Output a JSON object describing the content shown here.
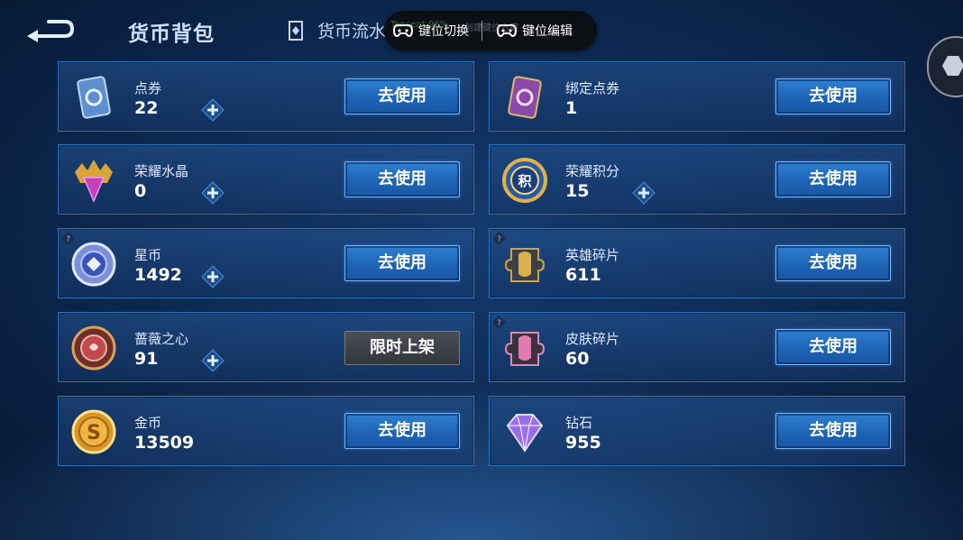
{
  "header": {
    "title": "货币背包",
    "tab_flow": "货币流水"
  },
  "overlay": {
    "ghost_text_1": "Tencent 96%",
    "ghost_text_2": "创建键位方案",
    "switch_label": "键位切换",
    "edit_label": "键位编辑"
  },
  "items": [
    {
      "name": "点券",
      "amount": "22",
      "action": "去使用",
      "icon": "coupon-card-icon",
      "has_plus": true,
      "has_help": false
    },
    {
      "name": "绑定点券",
      "amount": "1",
      "action": "去使用",
      "icon": "bound-coupon-card-icon",
      "has_plus": false,
      "has_help": false
    },
    {
      "name": "荣耀水晶",
      "amount": "0",
      "action": "去使用",
      "icon": "glory-crystal-icon",
      "has_plus": true,
      "has_help": false
    },
    {
      "name": "荣耀积分",
      "amount": "15",
      "action": "去使用",
      "icon": "glory-points-icon",
      "has_plus": true,
      "has_help": false
    },
    {
      "name": "星币",
      "amount": "1492",
      "action": "去使用",
      "icon": "star-coin-icon",
      "has_plus": true,
      "has_help": true
    },
    {
      "name": "英雄碎片",
      "amount": "611",
      "action": "去使用",
      "icon": "hero-fragment-icon",
      "has_plus": false,
      "has_help": true
    },
    {
      "name": "蔷薇之心",
      "amount": "91",
      "action": "限时上架",
      "icon": "rose-heart-icon",
      "has_plus": true,
      "has_help": false
    },
    {
      "name": "皮肤碎片",
      "amount": "60",
      "action": "去使用",
      "icon": "skin-fragment-icon",
      "has_plus": false,
      "has_help": true
    },
    {
      "name": "金币",
      "amount": "13509",
      "action": "去使用",
      "icon": "gold-coin-icon",
      "has_plus": false,
      "has_help": false
    },
    {
      "name": "钻石",
      "amount": "955",
      "action": "去使用",
      "icon": "diamond-icon",
      "has_plus": false,
      "has_help": false
    }
  ],
  "colors": {
    "button_blue": "#1e64b5",
    "card_border": "#2f72b5",
    "disabled_button": "#3f4349"
  }
}
